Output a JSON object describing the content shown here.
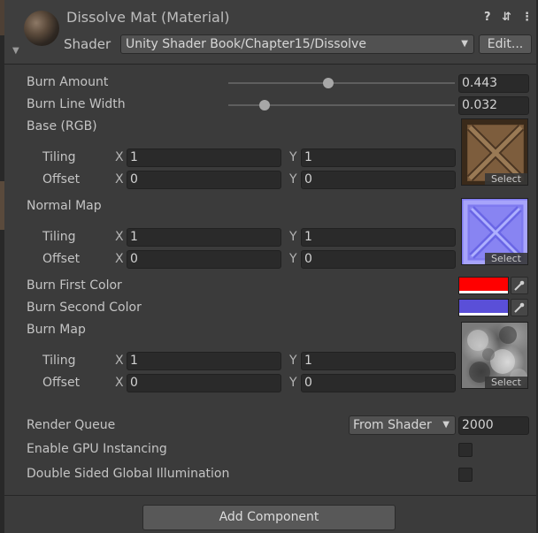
{
  "header": {
    "title": "Dissolve Mat (Material)",
    "shader_label": "Shader",
    "shader_value": "Unity Shader Book/Chapter15/Dissolve",
    "edit_label": "Edit...",
    "icons": [
      "help-icon",
      "preset-icon",
      "more-icon"
    ]
  },
  "properties": {
    "burn_amount": {
      "label": "Burn Amount",
      "value": "0.443",
      "slider_fraction": 0.443
    },
    "burn_line_width": {
      "label": "Burn Line Width",
      "value": "0.032",
      "slider_fraction": 0.16
    },
    "base": {
      "label": "Base (RGB)",
      "tiling_label": "Tiling",
      "offset_label": "Offset",
      "tiling_x": "1",
      "tiling_y": "1",
      "offset_x": "0",
      "offset_y": "0",
      "select_label": "Select"
    },
    "normal_map": {
      "label": "Normal Map",
      "tiling_label": "Tiling",
      "offset_label": "Offset",
      "tiling_x": "1",
      "tiling_y": "1",
      "offset_x": "0",
      "offset_y": "0",
      "select_label": "Select"
    },
    "burn_first_color": {
      "label": "Burn First Color",
      "color": "#ff0000"
    },
    "burn_second_color": {
      "label": "Burn Second Color",
      "color": "#5a4fd8"
    },
    "burn_map": {
      "label": "Burn Map",
      "tiling_label": "Tiling",
      "offset_label": "Offset",
      "tiling_x": "1",
      "tiling_y": "1",
      "offset_x": "0",
      "offset_y": "0",
      "select_label": "Select"
    }
  },
  "axes": {
    "x": "X",
    "y": "Y"
  },
  "render_queue": {
    "label": "Render Queue",
    "mode": "From Shader",
    "value": "2000"
  },
  "gpu_instancing": {
    "label": "Enable GPU Instancing",
    "checked": false
  },
  "double_sided_gi": {
    "label": "Double Sided Global Illumination",
    "checked": false
  },
  "add_component_label": "Add Component"
}
